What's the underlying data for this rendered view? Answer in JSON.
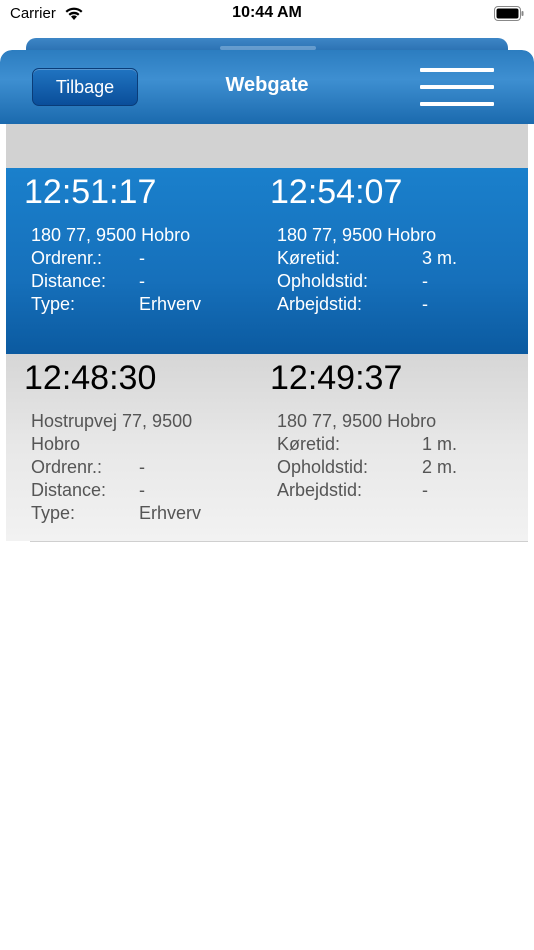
{
  "status_bar": {
    "carrier": "Carrier",
    "time": "10:44 AM"
  },
  "nav": {
    "back_label": "Tilbage",
    "title": "Webgate"
  },
  "colors": {
    "nav_blue": "#2c7dc0",
    "selected_row_blue": "#1670bb",
    "spacer_gray": "#d2d2d2"
  },
  "rows": [
    {
      "left": {
        "time": "12:51:17",
        "address": "180 77, 9500 Hobro",
        "fields": [
          {
            "label": "Ordrenr.:",
            "value": "-"
          },
          {
            "label": "Distance:",
            "value": "-"
          },
          {
            "label": "Type:",
            "value": "Erhverv"
          }
        ]
      },
      "right": {
        "time": "12:54:07",
        "address": "180 77, 9500 Hobro",
        "fields": [
          {
            "label": "Køretid:",
            "value": "3 m."
          },
          {
            "label": "Opholdstid:",
            "value": "-"
          },
          {
            "label": "Arbejdstid:",
            "value": "-"
          }
        ]
      }
    },
    {
      "left": {
        "time": "12:48:30",
        "address": "Hostrupvej 77, 9500 Hobro",
        "fields": [
          {
            "label": "Ordrenr.:",
            "value": "-"
          },
          {
            "label": "Distance:",
            "value": "-"
          },
          {
            "label": "Type:",
            "value": "Erhverv"
          }
        ]
      },
      "right": {
        "time": "12:49:37",
        "address": "180 77, 9500 Hobro",
        "fields": [
          {
            "label": "Køretid:",
            "value": "1 m."
          },
          {
            "label": "Opholdstid:",
            "value": "2 m."
          },
          {
            "label": "Arbejdstid:",
            "value": "-"
          }
        ]
      }
    }
  ]
}
